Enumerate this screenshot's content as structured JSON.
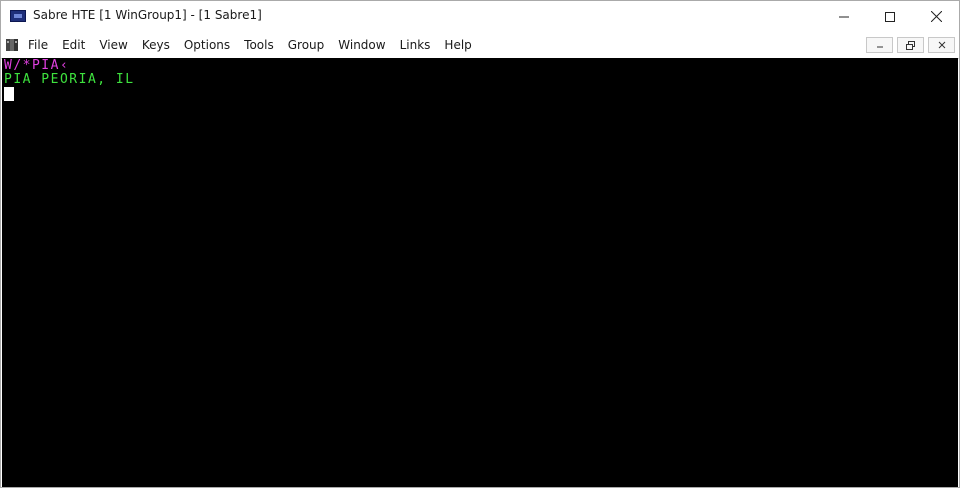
{
  "window": {
    "title": "Sabre HTE [1 WinGroup1] - [1 Sabre1]",
    "controls": {
      "minimize_icon": "minimize-icon",
      "maximize_icon": "maximize-icon",
      "close_icon": "close-icon"
    }
  },
  "menubar": {
    "items": [
      "File",
      "Edit",
      "View",
      "Keys",
      "Options",
      "Tools",
      "Group",
      "Window",
      "Links",
      "Help"
    ]
  },
  "terminal": {
    "lines": [
      {
        "text": "W/*PIA‹",
        "color": "#e040e0"
      },
      {
        "text": "PIA PEORIA, IL",
        "color": "#3ee23e"
      }
    ],
    "background": "#000000"
  }
}
